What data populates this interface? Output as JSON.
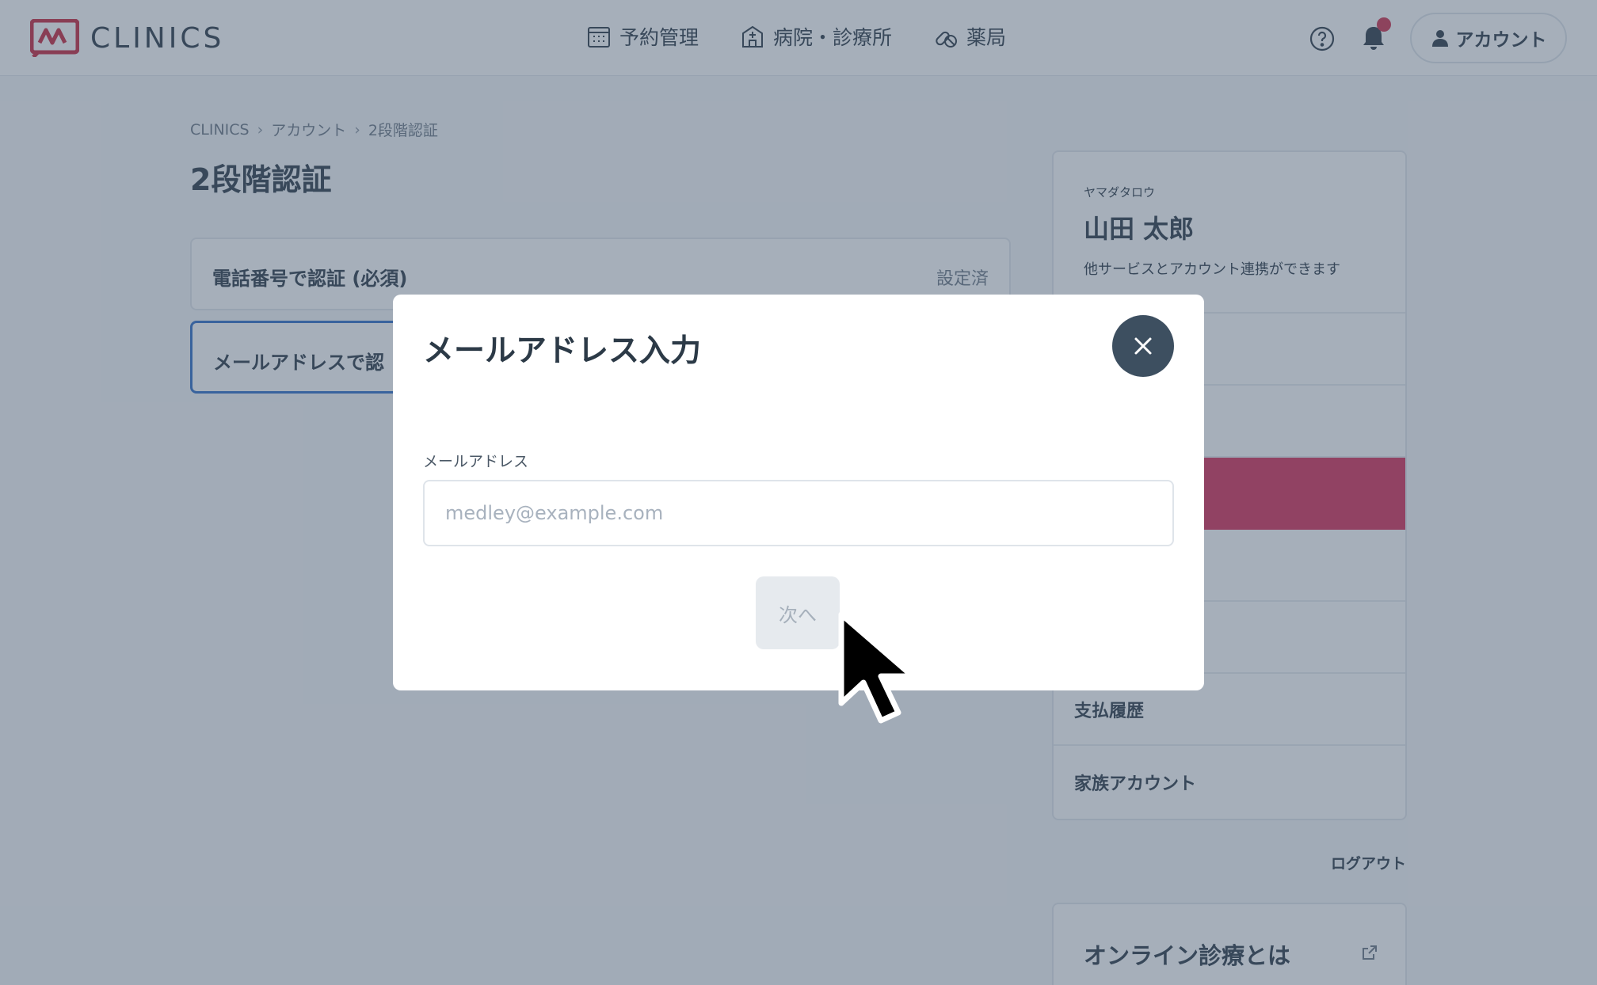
{
  "header": {
    "logo_text": "CLINICS",
    "nav": [
      {
        "label": "予約管理",
        "icon": "calendar-icon"
      },
      {
        "label": "病院・診療所",
        "icon": "hospital-icon"
      },
      {
        "label": "薬局",
        "icon": "pharmacy-icon"
      }
    ],
    "account_label": "アカウント"
  },
  "breadcrumb": [
    "CLINICS",
    "アカウント",
    "2段階認証"
  ],
  "page_title": "2段階認証",
  "cards": {
    "phone": {
      "label": "電話番号で認証 (必須)",
      "status": "設定済"
    },
    "mail": {
      "label": "メールアドレスで認"
    }
  },
  "sidebar": {
    "kana": "ヤマダタロウ",
    "name": "山田 太郎",
    "note": "他サービスとアカウント連携ができます",
    "items": [
      "支払履歴",
      "家族アカウント"
    ]
  },
  "logout_label": "ログアウト",
  "online_card_label": "オンライン診療とは",
  "modal": {
    "title": "メールアドレス入力",
    "field_label": "メールアドレス",
    "email_placeholder": "medley@example.com",
    "email_value": "",
    "next_label": "次へ"
  },
  "colors": {
    "brand": "#d0304d",
    "sidebar_active": "#d62e58",
    "focus_border": "#2f6dc7",
    "close_button": "#3d4f60",
    "text": "#2c3a47"
  }
}
